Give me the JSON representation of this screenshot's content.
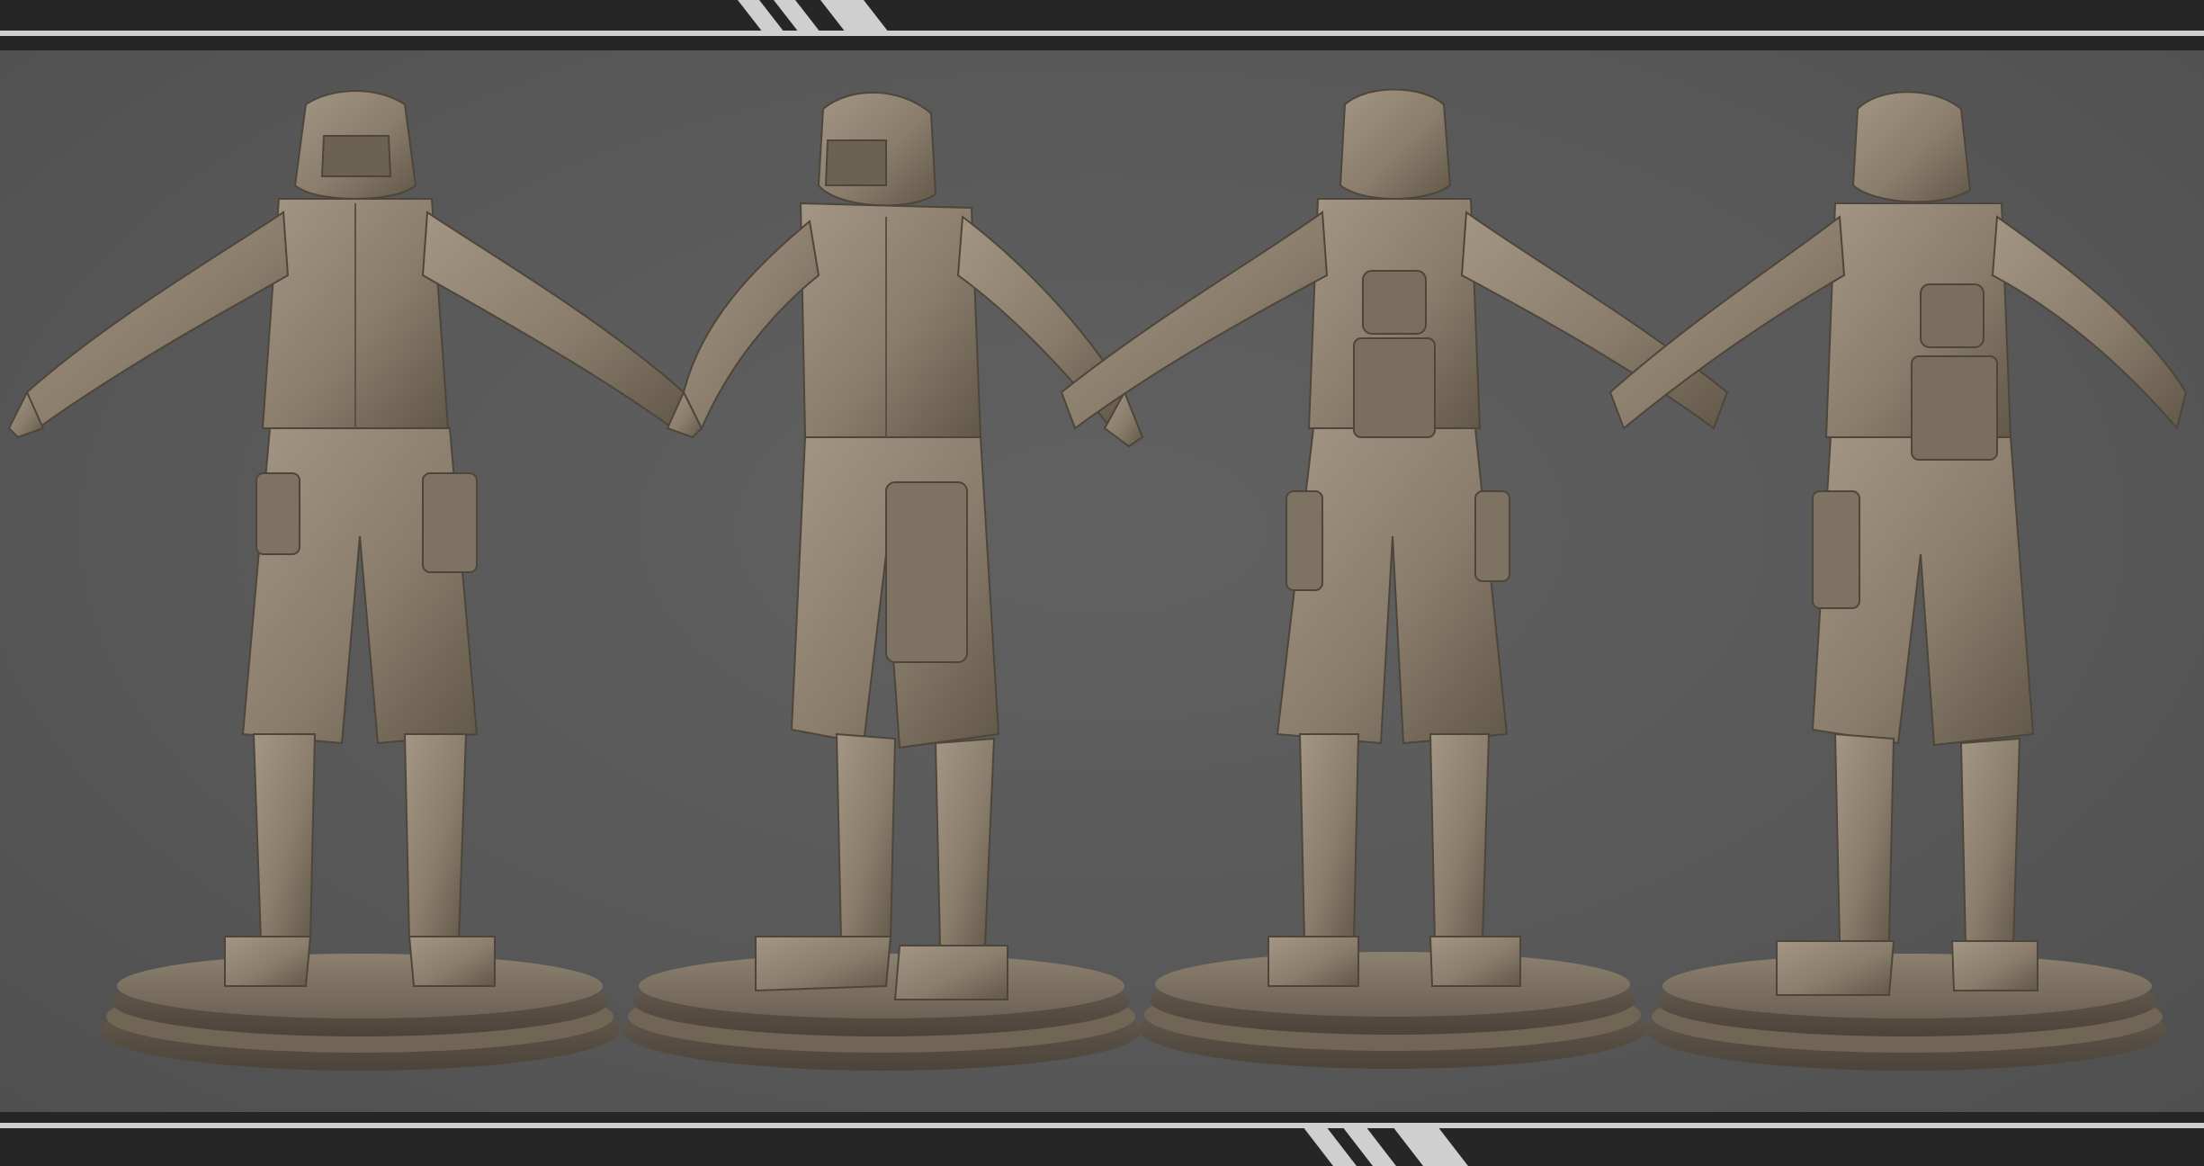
{
  "palette": {
    "background": "#5a5a5a",
    "band": "#262626",
    "rule": "#cfcfcf",
    "clay": "#8a7d6c",
    "clay_light": "#a39684",
    "clay_dark": "#5e5447",
    "base": "#7d7162"
  },
  "views": [
    {
      "id": "front",
      "label": ""
    },
    {
      "id": "three-quarter-front",
      "label": ""
    },
    {
      "id": "back",
      "label": ""
    },
    {
      "id": "three-quarter-back",
      "label": ""
    }
  ]
}
